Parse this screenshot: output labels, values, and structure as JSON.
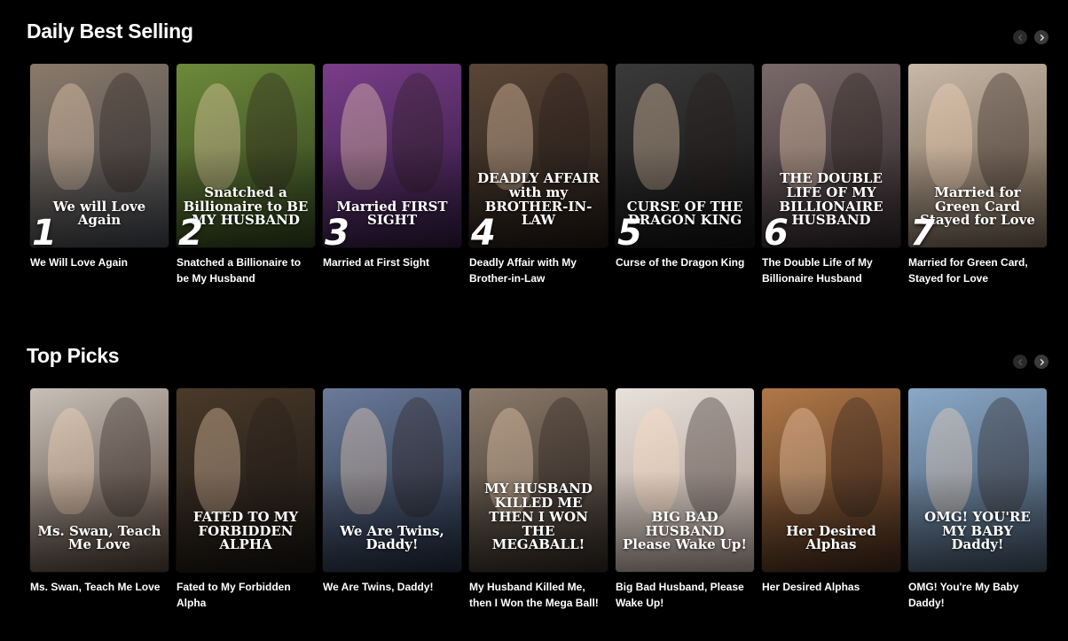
{
  "sections": [
    {
      "title": "Daily Best Selling",
      "books": [
        {
          "title": "We Will Love Again",
          "cover_text": "We will Love Again",
          "rank": "1",
          "colors": [
            "#8a7a6a",
            "#3a3e45"
          ]
        },
        {
          "title": "Snatched a Billionaire to be My Husband",
          "cover_text": "Snatched a Billionaire to BE MY HUSBAND",
          "rank": "2",
          "colors": [
            "#6d8a3a",
            "#2b3a1a"
          ]
        },
        {
          "title": "Married at First Sight",
          "cover_text": "Married FIRST SIGHT",
          "rank": "3",
          "colors": [
            "#7a3d8a",
            "#2a1838"
          ]
        },
        {
          "title": "Deadly Affair with My Brother-in-Law",
          "cover_text": "DEADLY AFFAIR with my BROTHER-IN-LAW",
          "rank": "4",
          "colors": [
            "#5a4638",
            "#1c1612"
          ]
        },
        {
          "title": "Curse of the Dragon King",
          "cover_text": "CURSE OF THE DRAGON KING",
          "rank": "5",
          "colors": [
            "#3a3a3a",
            "#101010"
          ]
        },
        {
          "title": "The Double Life of My Billionaire Husband",
          "cover_text": "THE DOUBLE LIFE OF MY BILLIONAIRE HUSBAND",
          "rank": "6",
          "colors": [
            "#7a6a6a",
            "#2a2226"
          ]
        },
        {
          "title": "Married for Green Card, Stayed for Love",
          "cover_text": "Married for Green Card Stayed for Love",
          "rank": "7",
          "colors": [
            "#c8b8a8",
            "#6a5a4a"
          ]
        }
      ]
    },
    {
      "title": "Top Picks",
      "books": [
        {
          "title": "Ms. Swan, Teach Me Love",
          "cover_text": "Ms. Swan, Teach Me Love",
          "rank": "",
          "colors": [
            "#c8c0b8",
            "#4a3a30"
          ]
        },
        {
          "title": "Fated to My Forbidden Alpha",
          "cover_text": "FATED TO MY FORBIDDEN ALPHA",
          "rank": "",
          "colors": [
            "#4a3a2a",
            "#141210"
          ]
        },
        {
          "title": "We Are Twins, Daddy!",
          "cover_text": "We Are Twins, Daddy!",
          "rank": "",
          "colors": [
            "#6a7a9a",
            "#1e2838"
          ]
        },
        {
          "title": "My Husband Killed Me, then I Won the Mega Ball!",
          "cover_text": "MY HUSBAND KILLED ME THEN I WON THE MEGABALL!",
          "rank": "",
          "colors": [
            "#8a7a6a",
            "#2a2420"
          ]
        },
        {
          "title": "Big Bad Husband, Please Wake Up!",
          "cover_text": "BIG BAD HUSBAND Please Wake Up!",
          "rank": "",
          "colors": [
            "#e8e0da",
            "#a89890"
          ]
        },
        {
          "title": "Her Desired Alphas",
          "cover_text": "Her Desired Alphas",
          "rank": "",
          "colors": [
            "#b07848",
            "#3a2418"
          ]
        },
        {
          "title": "OMG! You're My Baby Daddy!",
          "cover_text": "OMG! YOU'RE MY BABY Daddy!",
          "rank": "",
          "colors": [
            "#8aa8c8",
            "#3a4a5a"
          ]
        }
      ]
    }
  ],
  "icons": {
    "prev": "chevron-left-icon",
    "next": "chevron-right-icon"
  }
}
